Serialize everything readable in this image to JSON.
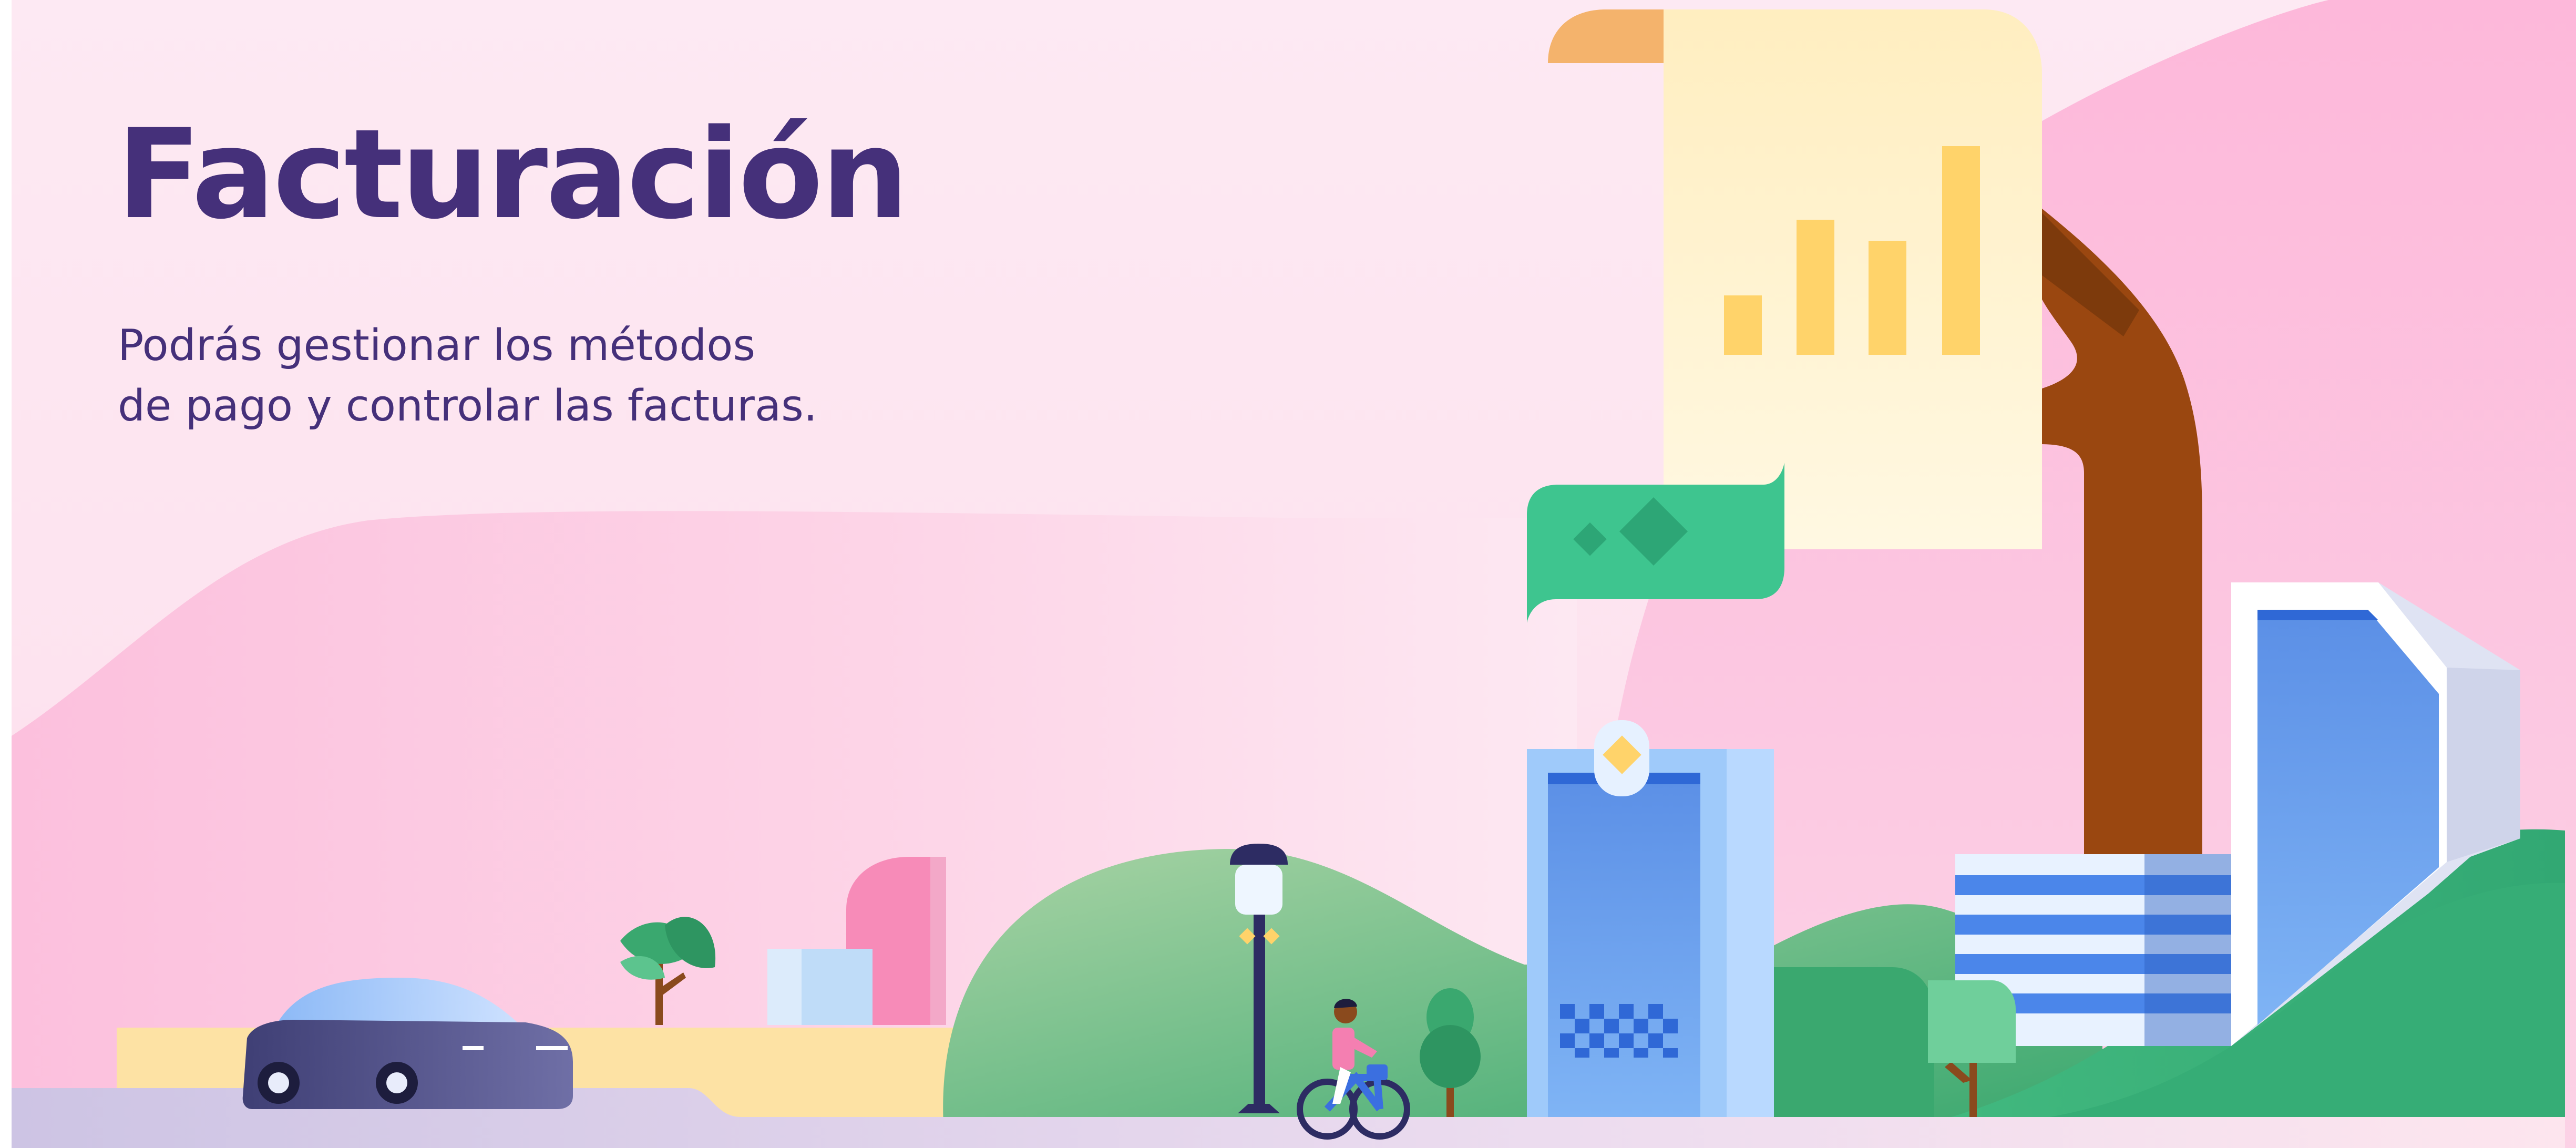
{
  "banner": {
    "title": "Facturación",
    "subtitle_lines": [
      "Podrás gestionar los métodos",
      "de pago y controlar las facturas."
    ]
  },
  "colors": {
    "title_text": "#45307a",
    "background": "#fde6f1",
    "hill_pink": "#fcc4e0",
    "hill_green": "#3fb37c",
    "document": "#fff5cc",
    "document_bars": "#ffd36a",
    "banknote": "#3ec58f",
    "hand": "#9a4710",
    "building_blue": "#5d97ea",
    "car": "#4d4f82"
  },
  "illustration": {
    "icons": [
      "document-chart-icon",
      "banknote-icon",
      "hand-icon",
      "car-icon",
      "cyclist-icon",
      "street-lamp-icon",
      "building-icon",
      "tree-icon"
    ]
  }
}
